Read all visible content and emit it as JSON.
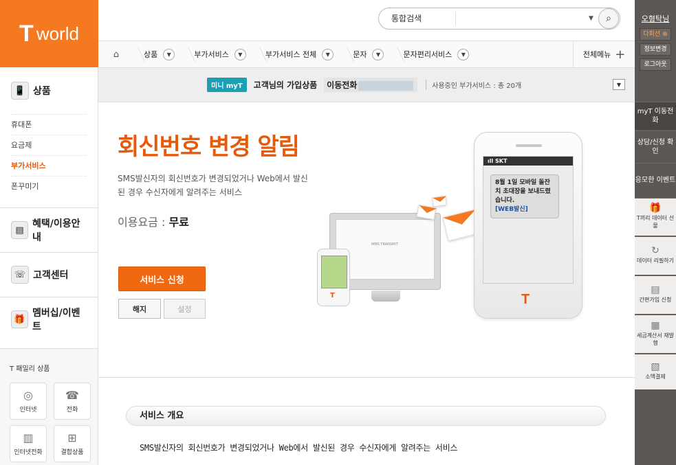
{
  "logo": {
    "mark": "T",
    "word": "world"
  },
  "search": {
    "scope": "통합검색",
    "placeholder": ""
  },
  "nav": {
    "home": "⌂",
    "items": [
      "상품",
      "부가서비스",
      "부가서비스 전체",
      "문자",
      "문자편리서비스"
    ],
    "all_menu": "전체메뉴"
  },
  "sidebar": {
    "product": "상품",
    "product_items": [
      "휴대폰",
      "요금제",
      "부가서비스",
      "폰꾸미기"
    ],
    "benefit": "혜택/이용안내",
    "customer": "고객센터",
    "membership": "멤버십/이벤트",
    "family_title": "T 패밀리 상품",
    "family": [
      "인터넷",
      "전화",
      "인터넷전화",
      "결합상품"
    ]
  },
  "subbar": {
    "badge": "미니 myT",
    "label": "고객님의 가입상품",
    "product": "이동전화",
    "count": "사용중인 부가서비스 : 총 20개"
  },
  "hero": {
    "title": "회신번호 변경 알림",
    "desc": "SMS발신자의 회신번호가 변경되었거나 Web에서 발신된 경우 수신자에게 알려주는 서비스",
    "fee_label": "이용요금 : ",
    "fee_value": "무료",
    "apply": "서비스 신청",
    "cancel": "해지",
    "setting": "설정",
    "phone_status": "SKT",
    "phone_msg": "8월 1일 모바일 돌잔치 초대장을 보내드렸습니다.",
    "phone_tag": "[WEB발신]",
    "mms_label": "MMS TRANSMIT"
  },
  "overview": {
    "title": "서비스 개요",
    "text": "SMS발신자의 회신번호가 변경되었거나 Web에서 발신된 경우 수신자에게 알려주는 서비스"
  },
  "rightbar": {
    "user": "오형탁님",
    "charge": "다회선 ⊕",
    "edit": "정보변경",
    "logout": "로그아웃",
    "menus": [
      "myT 이동전화",
      "상담/신청 확인",
      "응모한 이벤트"
    ],
    "icon_menus": [
      "T끼리 데이터 선물",
      "데이터 리필하기",
      "간편가입 신청",
      "세금계산서 재발행",
      "소액결제"
    ]
  }
}
